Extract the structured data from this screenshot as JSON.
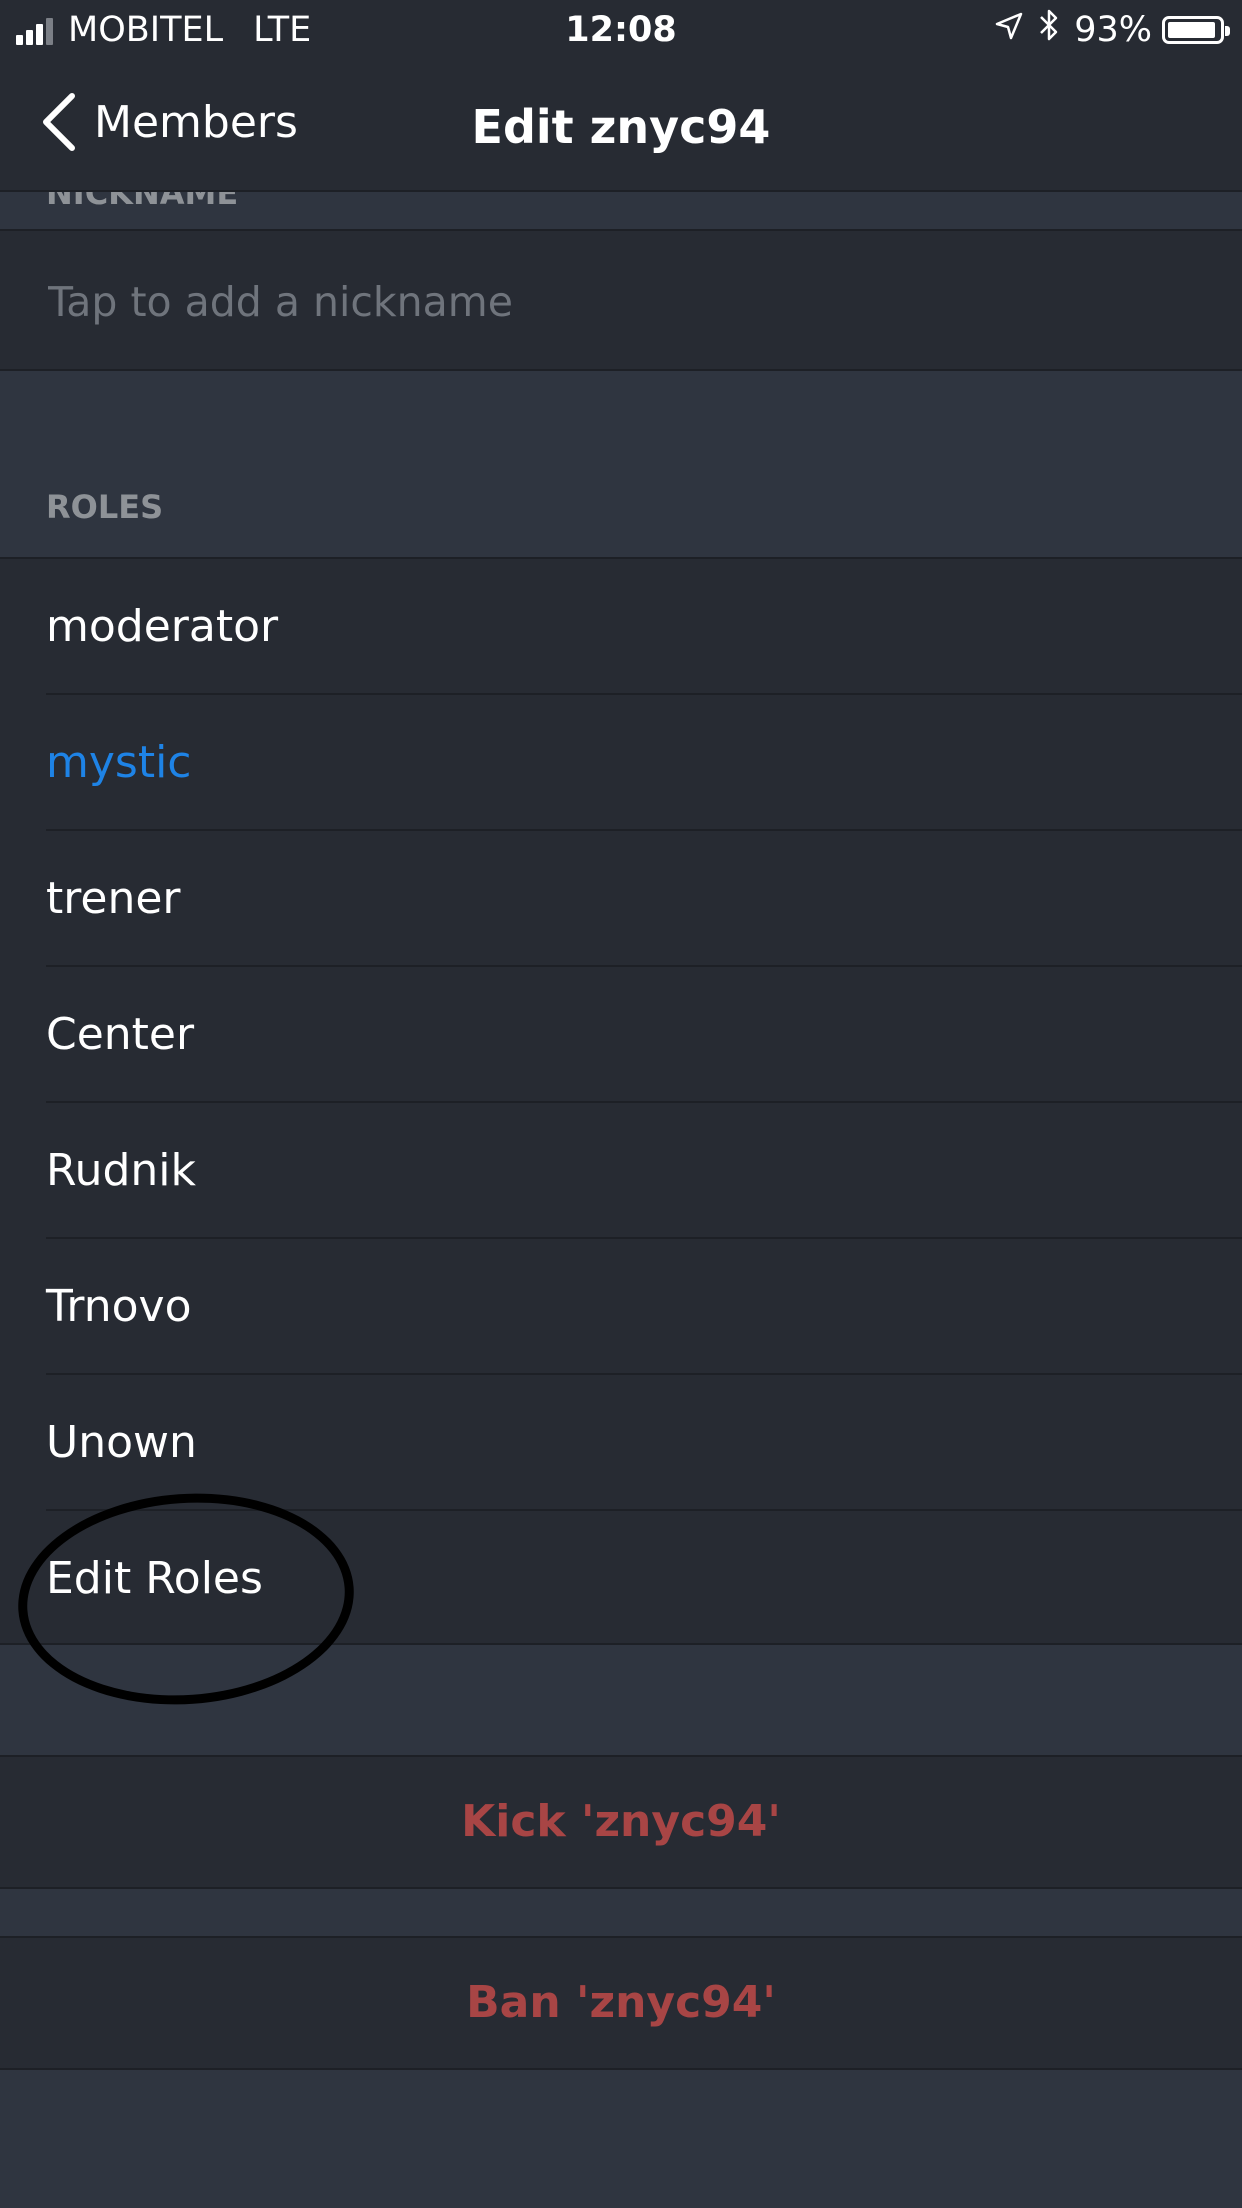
{
  "status_bar": {
    "carrier": "MOBITEL",
    "network": "LTE",
    "time": "12:08",
    "battery_text": "93%",
    "battery_level": 0.93,
    "signal_bars_filled": 3,
    "signal_bars_total": 4
  },
  "nav": {
    "back_label": "Members",
    "title": "Edit znyc94"
  },
  "nickname": {
    "header": "NICKNAME",
    "placeholder": "Tap to add a nickname",
    "value": ""
  },
  "roles": {
    "header": "ROLES",
    "items": [
      {
        "label": "moderator"
      },
      {
        "label": "mystic",
        "color": "#1e83e6"
      },
      {
        "label": "trener"
      },
      {
        "label": "Center"
      },
      {
        "label": "Rudnik"
      },
      {
        "label": "Trnovo"
      },
      {
        "label": "Unown"
      }
    ],
    "edit_label": "Edit Roles"
  },
  "actions": {
    "kick_label": "Kick 'znyc94'",
    "ban_label": "Ban 'znyc94'"
  },
  "colors": {
    "background": "#2f3540",
    "row_background": "#272b33",
    "accent_blue": "#1e83e6",
    "danger_red": "#a84545"
  }
}
